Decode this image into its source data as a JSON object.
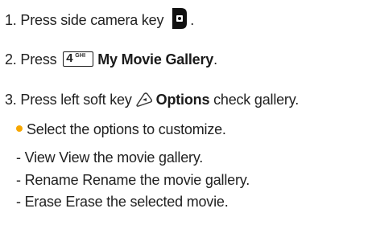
{
  "steps": {
    "s1": {
      "text": "1. Press side camera key",
      "icon": "camera-key-icon",
      "end": "."
    },
    "s2": {
      "prefix": "2. Press",
      "key_number": "4",
      "key_letters": "GHI",
      "bold": "My Movie Gallery",
      "end": "."
    },
    "s3": {
      "prefix": "3. Press left soft key",
      "icon": "left-soft-key-icon",
      "bold": "Options",
      "suffix": "check gallery."
    }
  },
  "bullet": {
    "text": "Select the options to customize.",
    "color": "#f7a700"
  },
  "options": [
    "- View  View the movie gallery.",
    "- Rename  Rename the movie gallery.",
    "- Erase  Erase the selected movie."
  ]
}
